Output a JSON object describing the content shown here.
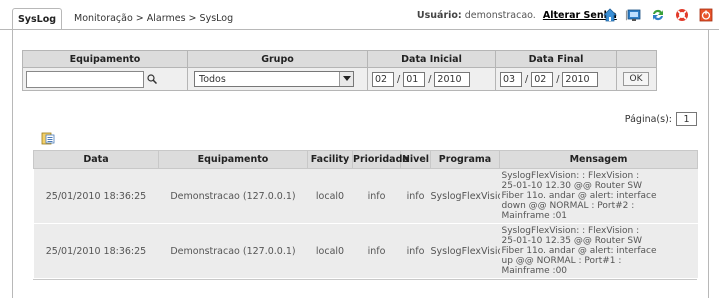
{
  "header": {
    "tab_label": "SysLog",
    "breadcrumb": "Monitoração > Alarmes > SysLog",
    "user_label": "Usuário:",
    "user_name": "demonstracao.",
    "change_password": "Alterar Senha",
    "separator": "|"
  },
  "filters": {
    "headers": [
      "Equipamento",
      "Grupo",
      "Data Inicial",
      "Data Final"
    ],
    "equipamento_value": "",
    "grupo_value": "Todos",
    "data_inicial": {
      "day": "02",
      "month": "01",
      "year": "2010"
    },
    "data_final": {
      "day": "03",
      "month": "02",
      "year": "2010"
    },
    "date_separator": "/",
    "ok_label": "OK"
  },
  "pagination": {
    "label": "Página(s):",
    "value": "1"
  },
  "results": {
    "headers": [
      "Data",
      "Equipamento",
      "Facility",
      "Prioridade",
      "Nivel",
      "Programa",
      "Mensagem"
    ],
    "rows": [
      {
        "data": "25/01/2010 18:36:25",
        "equipamento": "Demonstracao (127.0.0.1)",
        "facility": "local0",
        "prioridade": "info",
        "nivel": "info",
        "programa": "SyslogFlexVisio",
        "mensagem": [
          "SyslogFlexVision: : FlexVision :",
          "25-01-10 12.30 @@ Router SW",
          "Fiber 11o. andar @ alert: interface",
          "down @@ NORMAL : Port#2 :",
          "Mainframe :01"
        ]
      },
      {
        "data": "25/01/2010 18:36:25",
        "equipamento": "Demonstracao (127.0.0.1)",
        "facility": "local0",
        "prioridade": "info",
        "nivel": "info",
        "programa": "SyslogFlexVisio",
        "mensagem": [
          "SyslogFlexVision: : FlexVision :",
          "25-01-10 12.35 @@ Router SW",
          "Fiber 11o. andar @ alert: interface",
          "up @@ NORMAL : Port#1 :",
          "Mainframe :00"
        ]
      }
    ]
  },
  "icons": [
    "home-icon",
    "monitor-icon",
    "refresh-icon",
    "help-lifebuoy-icon",
    "power-icon"
  ],
  "colors": {
    "header_bg": "#dcdcdc",
    "row_bg": "#ececec",
    "accent_red": "#d9331a"
  }
}
